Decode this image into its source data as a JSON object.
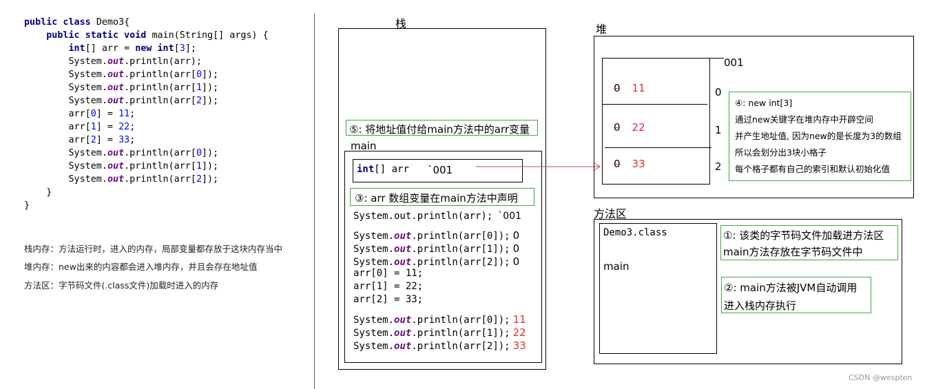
{
  "code": {
    "lines": [
      [
        {
          "t": "public class ",
          "c": "kw"
        },
        {
          "t": "Demo3{",
          "c": ""
        }
      ],
      [
        {
          "t": "    public static void ",
          "c": "kw"
        },
        {
          "t": "main(String[] args) {",
          "c": ""
        }
      ],
      [
        {
          "t": "        ",
          "c": ""
        },
        {
          "t": "int",
          "c": "kw"
        },
        {
          "t": "[] arr = ",
          "c": ""
        },
        {
          "t": "new int",
          "c": "kw"
        },
        {
          "t": "[",
          "c": ""
        },
        {
          "t": "3",
          "c": "num"
        },
        {
          "t": "];",
          "c": ""
        }
      ],
      [
        {
          "t": "        System.",
          "c": ""
        },
        {
          "t": "out",
          "c": "out"
        },
        {
          "t": ".println(arr);",
          "c": ""
        }
      ],
      [
        {
          "t": "        System.",
          "c": ""
        },
        {
          "t": "out",
          "c": "out"
        },
        {
          "t": ".println(arr[",
          "c": ""
        },
        {
          "t": "0",
          "c": "num"
        },
        {
          "t": "]);",
          "c": ""
        }
      ],
      [
        {
          "t": "        System.",
          "c": ""
        },
        {
          "t": "out",
          "c": "out"
        },
        {
          "t": ".println(arr[",
          "c": ""
        },
        {
          "t": "1",
          "c": "num"
        },
        {
          "t": "]);",
          "c": ""
        }
      ],
      [
        {
          "t": "        System.",
          "c": ""
        },
        {
          "t": "out",
          "c": "out"
        },
        {
          "t": ".println(arr[",
          "c": ""
        },
        {
          "t": "2",
          "c": "num"
        },
        {
          "t": "]);",
          "c": ""
        }
      ],
      [
        {
          "t": "        arr[",
          "c": ""
        },
        {
          "t": "0",
          "c": "num"
        },
        {
          "t": "] = ",
          "c": ""
        },
        {
          "t": "11",
          "c": "num"
        },
        {
          "t": ";",
          "c": ""
        }
      ],
      [
        {
          "t": "        arr[",
          "c": ""
        },
        {
          "t": "1",
          "c": "num"
        },
        {
          "t": "] = ",
          "c": ""
        },
        {
          "t": "22",
          "c": "num"
        },
        {
          "t": ";",
          "c": ""
        }
      ],
      [
        {
          "t": "        arr[",
          "c": ""
        },
        {
          "t": "2",
          "c": "num"
        },
        {
          "t": "] = ",
          "c": ""
        },
        {
          "t": "33",
          "c": "num"
        },
        {
          "t": ";",
          "c": ""
        }
      ],
      [
        {
          "t": "        System.",
          "c": ""
        },
        {
          "t": "out",
          "c": "out"
        },
        {
          "t": ".println(arr[",
          "c": ""
        },
        {
          "t": "0",
          "c": "num"
        },
        {
          "t": "]);",
          "c": ""
        }
      ],
      [
        {
          "t": "        System.",
          "c": ""
        },
        {
          "t": "out",
          "c": "out"
        },
        {
          "t": ".println(arr[",
          "c": ""
        },
        {
          "t": "1",
          "c": "num"
        },
        {
          "t": "]);",
          "c": ""
        }
      ],
      [
        {
          "t": "        System.",
          "c": ""
        },
        {
          "t": "out",
          "c": "out"
        },
        {
          "t": ".println(arr[",
          "c": ""
        },
        {
          "t": "2",
          "c": "num"
        },
        {
          "t": "]);",
          "c": ""
        }
      ],
      [
        {
          "t": "    }",
          "c": ""
        }
      ],
      [
        {
          "t": "}",
          "c": ""
        }
      ]
    ]
  },
  "notes": {
    "stack": "栈内存：方法运行时，进入的内存，局部变量都存放于这块内存当中",
    "heap": "堆内存：new出来的内容都会进入堆内存，并且会存在地址值",
    "method": "方法区：字节码文件(.class文件)加载时进入的内存"
  },
  "stack": {
    "title": "栈",
    "step5": "⑤: 将地址值付给main方法中的arr变量",
    "main_label": "main",
    "arr_decl_kw": "int",
    "arr_decl_rest": "[] arr",
    "arr_addr": "`001",
    "step3": "③: arr 数组变量在main方法中声明",
    "print_arr": "System.out.println(arr);",
    "print_arr_val": "`001",
    "print_rows": [
      {
        "pre": "System.",
        "out": "out",
        "post": ".println(arr[0]);",
        "val": "0"
      },
      {
        "pre": "System.",
        "out": "out",
        "post": ".println(arr[1]);",
        "val": "0"
      },
      {
        "pre": "System.",
        "out": "out",
        "post": ".println(arr[2]);",
        "val": "0"
      }
    ],
    "assigns": [
      "arr[0] = 11;",
      "arr[1] = 22;",
      "arr[2] = 33;"
    ],
    "print_rows2": [
      {
        "pre": "System.",
        "out": "out",
        "post": ".println(arr[0]);",
        "val": "11"
      },
      {
        "pre": "System.",
        "out": "out",
        "post": ".println(arr[1]);",
        "val": "22"
      },
      {
        "pre": "System.",
        "out": "out",
        "post": ".println(arr[2]);",
        "val": "33"
      }
    ]
  },
  "heap": {
    "title": "堆",
    "addr": "001",
    "cells": [
      {
        "old": "0",
        "new": "11",
        "index": "0"
      },
      {
        "old": "0",
        "new": "22",
        "index": "1"
      },
      {
        "old": "0",
        "new": "33",
        "index": "2"
      }
    ],
    "step4_lines": [
      "④: new int[3]",
      "通过new关键字在堆内存中开辟空间",
      "并产生地址值, 因为new的是长度为3的数组",
      "所以会划分出3块小格子",
      "每个格子都有自己的索引和默认初始化值"
    ]
  },
  "method_area": {
    "title": "方法区",
    "class_name": "Demo3.class",
    "main_label": "main",
    "step1_lines": [
      "①: 该类的字节码文件加载进方法区",
      "main方法存放在字节码文件中"
    ],
    "step2_lines": [
      "②: main方法被JVM自动调用",
      "进入栈内存执行"
    ]
  },
  "watermark": "CSDN @wespten",
  "colors": {
    "keyword": "#000080",
    "number": "#0000ff",
    "field": "#660e7a",
    "value_red": "#e03030",
    "note_border": "#3aa845"
  }
}
